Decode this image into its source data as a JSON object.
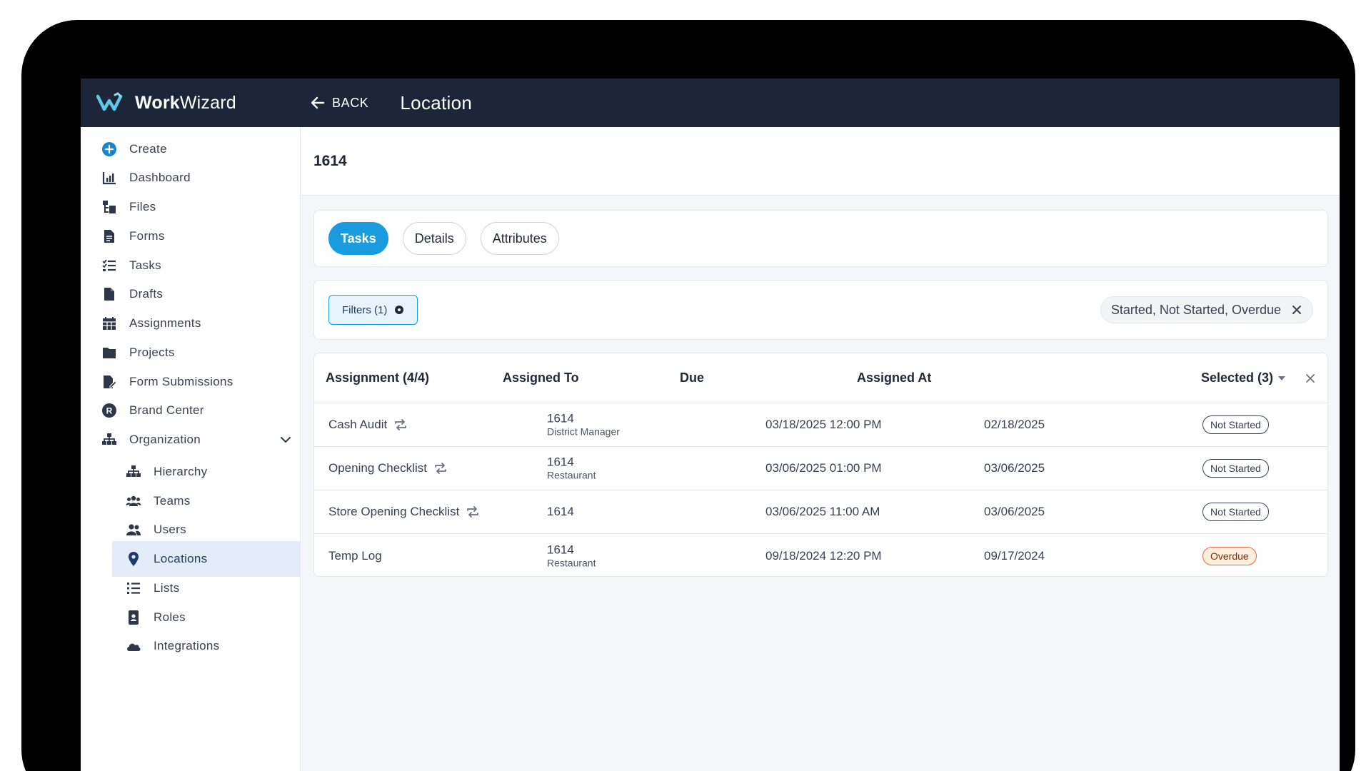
{
  "brand": {
    "name_bold": "Work",
    "name_light": "Wizard"
  },
  "topbar": {
    "back_label": "BACK",
    "page_title": "Location"
  },
  "sidebar": {
    "items": [
      {
        "label": "Create",
        "icon": "plus-circle-icon"
      },
      {
        "label": "Dashboard",
        "icon": "bar-chart-icon"
      },
      {
        "label": "Files",
        "icon": "folder-tree-icon"
      },
      {
        "label": "Forms",
        "icon": "document-icon"
      },
      {
        "label": "Tasks",
        "icon": "checklist-icon"
      },
      {
        "label": "Drafts",
        "icon": "draft-icon"
      },
      {
        "label": "Assignments",
        "icon": "calendar-icon"
      },
      {
        "label": "Projects",
        "icon": "folder-icon"
      },
      {
        "label": "Form Submissions",
        "icon": "file-edit-icon"
      },
      {
        "label": "Brand Center",
        "icon": "registered-icon"
      },
      {
        "label": "Organization",
        "icon": "sitemap-icon"
      }
    ],
    "sub_items": [
      {
        "label": "Hierarchy",
        "icon": "sitemap-icon"
      },
      {
        "label": "Teams",
        "icon": "users-group-icon"
      },
      {
        "label": "Users",
        "icon": "users-icon"
      },
      {
        "label": "Locations",
        "icon": "location-pin-icon"
      },
      {
        "label": "Lists",
        "icon": "list-icon"
      },
      {
        "label": "Roles",
        "icon": "badge-icon"
      },
      {
        "label": "Integrations",
        "icon": "cloud-icon"
      }
    ],
    "active": "Locations",
    "accent": "#1a9be0"
  },
  "record": {
    "title": "1614"
  },
  "tabs": [
    "Tasks",
    "Details",
    "Attributes"
  ],
  "active_tab": "Tasks",
  "filters": {
    "button_label": "Filters (1)",
    "chip_label": "Started, Not Started, Overdue"
  },
  "table": {
    "headers": {
      "assignment": "Assignment (4/4)",
      "assigned_to": "Assigned To",
      "due": "Due",
      "assigned_at": "Assigned At",
      "selected": "Selected (3)"
    },
    "rows": [
      {
        "name": "Cash Audit",
        "recurring": true,
        "to": "1614",
        "to_sub": "District Manager",
        "due": "03/18/2025 12:00 PM",
        "at": "02/18/2025",
        "status": "Not Started"
      },
      {
        "name": "Opening Checklist",
        "recurring": true,
        "to": "1614",
        "to_sub": "Restaurant",
        "due": "03/06/2025 01:00 PM",
        "at": "03/06/2025",
        "status": "Not Started"
      },
      {
        "name": "Store Opening Checklist",
        "recurring": true,
        "to": "1614",
        "to_sub": "",
        "due": "03/06/2025 11:00 AM",
        "at": "03/06/2025",
        "status": "Not Started"
      },
      {
        "name": "Temp Log",
        "recurring": false,
        "to": "1614",
        "to_sub": "Restaurant",
        "due": "09/18/2024 12:20 PM",
        "at": "09/17/2024",
        "status": "Overdue"
      }
    ]
  },
  "colors": {
    "topbar": "#1c2638",
    "accent": "#1a9be0",
    "overdue": "#e36b3b"
  }
}
